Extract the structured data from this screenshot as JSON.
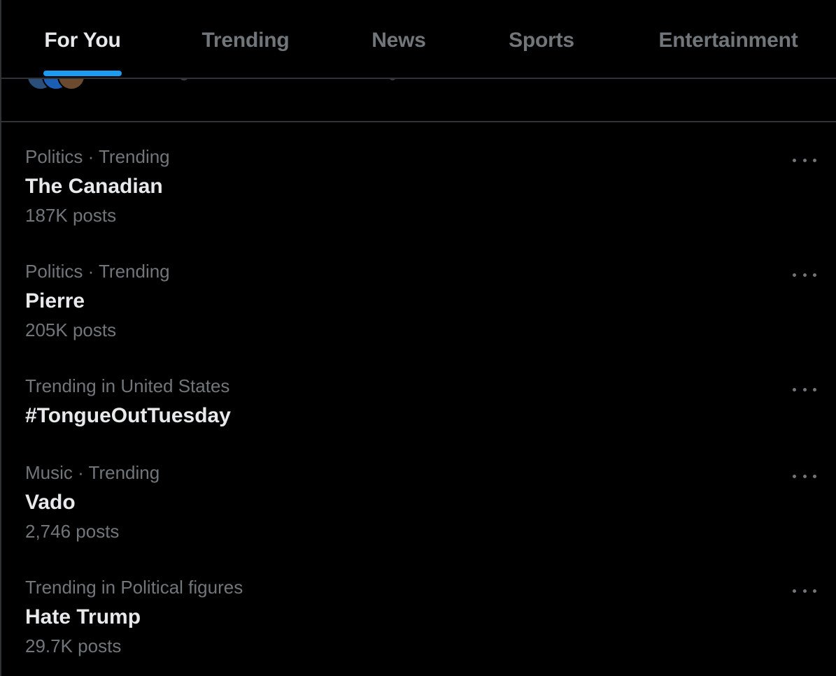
{
  "tabs": [
    {
      "label": "For You",
      "active": true
    },
    {
      "label": "Trending",
      "active": false
    },
    {
      "label": "News",
      "active": false
    },
    {
      "label": "Sports",
      "active": false
    },
    {
      "label": "Entertainment",
      "active": false
    }
  ],
  "trends": [
    {
      "meta": "Politics · Trending",
      "name": "The Canadian",
      "count": "187K posts"
    },
    {
      "meta": "Politics · Trending",
      "name": "Pierre",
      "count": "205K posts"
    },
    {
      "meta": "Trending in United States",
      "name": "#TongueOutTuesday",
      "count": ""
    },
    {
      "meta": "Music · Trending",
      "name": "Vado",
      "count": "2,746 posts"
    },
    {
      "meta": "Trending in Political figures",
      "name": "Hate Trump",
      "count": "29.7K posts"
    }
  ],
  "colors": {
    "background": "#000000",
    "accent": "#1d9bf0",
    "primary_text": "#e7e9ea",
    "secondary_text": "#71767b",
    "divider": "#2f3336"
  },
  "icons": {
    "more": "more-horizontal-icon"
  }
}
